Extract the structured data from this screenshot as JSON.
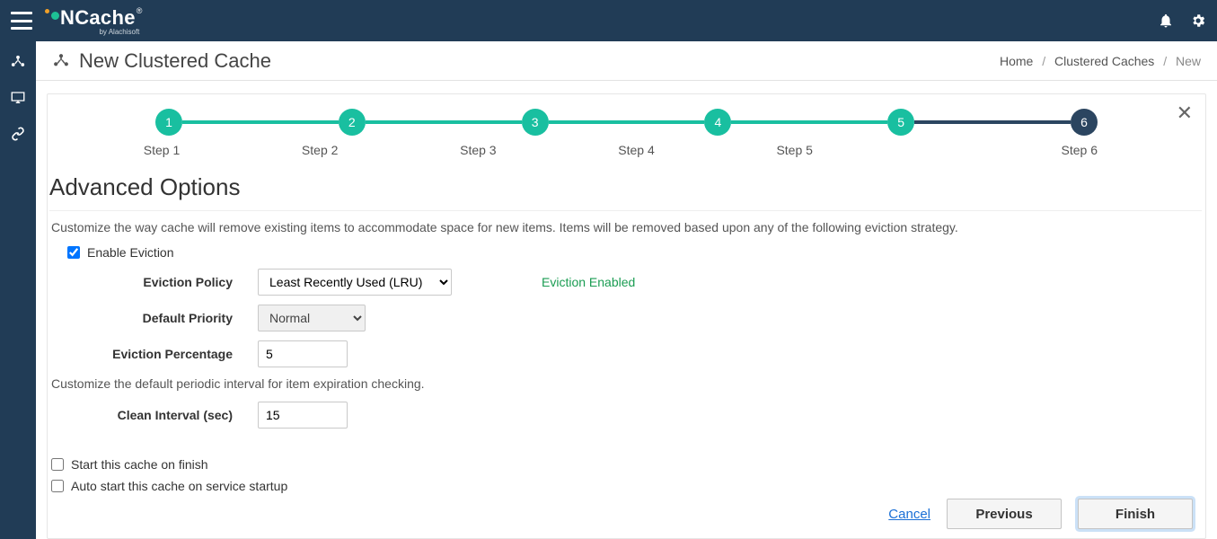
{
  "app": {
    "brand_prefix": "N",
    "brand_suffix": "Cache",
    "brand_sub": "by Alachisoft"
  },
  "header": {
    "title": "New Clustered Cache",
    "breadcrumb": {
      "home": "Home",
      "mid": "Clustered Caches",
      "current": "New"
    }
  },
  "stepper": {
    "steps": [
      {
        "num": "1",
        "label": "Step 1",
        "color": "#19bfa0"
      },
      {
        "num": "2",
        "label": "Step 2",
        "color": "#19bfa0"
      },
      {
        "num": "3",
        "label": "Step 3",
        "color": "#19bfa0"
      },
      {
        "num": "4",
        "label": "Step 4",
        "color": "#19bfa0"
      },
      {
        "num": "5",
        "label": "Step 5",
        "color": "#19bfa0"
      },
      {
        "num": "6",
        "label": "Step 6",
        "color": "#2b4560"
      }
    ],
    "active_index": 5
  },
  "section": {
    "title": "Advanced Options",
    "desc1": "Customize the way cache will remove existing items to accommodate space for new items. Items will be removed based upon any of the following eviction strategy.",
    "enable_eviction_label": "Enable Eviction",
    "eviction_policy_label": "Eviction Policy",
    "eviction_policy_value": "Least Recently Used (LRU)",
    "default_priority_label": "Default Priority",
    "default_priority_value": "Normal",
    "eviction_percentage_label": "Eviction Percentage",
    "eviction_percentage_value": "5",
    "status_text": "Eviction Enabled",
    "desc2": "Customize the default periodic interval for item expiration checking.",
    "clean_interval_label": "Clean Interval (sec)",
    "clean_interval_value": "15",
    "start_on_finish_label": "Start this cache on finish",
    "auto_start_label": "Auto start this cache on service startup"
  },
  "footer": {
    "cancel": "Cancel",
    "previous": "Previous",
    "finish": "Finish"
  }
}
